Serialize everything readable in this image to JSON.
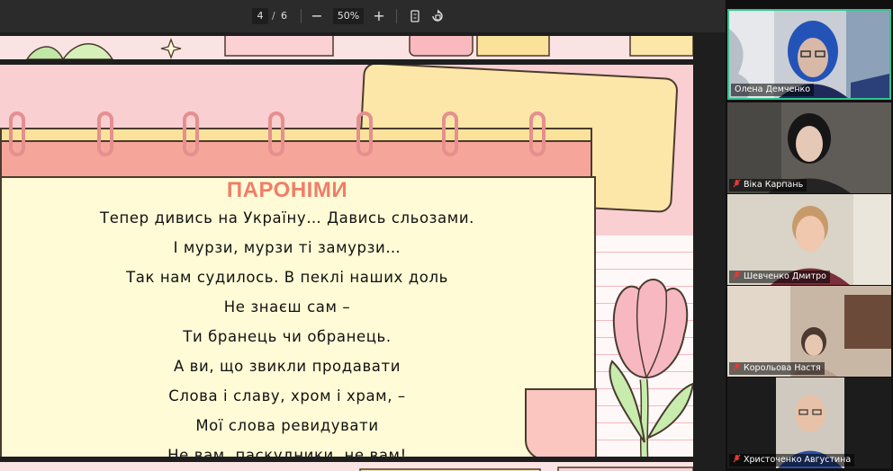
{
  "toolbar": {
    "current_page": "4",
    "separator": "/",
    "total_pages": "6",
    "zoom_out_label": "−",
    "zoom_level": "50%",
    "zoom_in_label": "+",
    "icons": [
      "fit-page-icon",
      "rotate-icon"
    ]
  },
  "slide": {
    "title": "ПАРОНІМИ",
    "lines": [
      "Тепер дивись на Україну… Давись сльозами.",
      "І мурзи, мурзи ті замурзи…",
      "Так нам судилось. В пеклі наших доль",
      "Не знаєш сам –",
      "Ти бранець чи обранець.",
      "А ви, що звикли продавати",
      "Слова і славу, хром і храм, –",
      "Мої слова ревидувати",
      "Не вам, паскудники, не вам!"
    ]
  },
  "participants": [
    {
      "name": "Олена Демченко",
      "muted": false,
      "active": true
    },
    {
      "name": "Віка Карпань",
      "muted": true,
      "active": false
    },
    {
      "name": "Шевченко Дмитро",
      "muted": true,
      "active": false
    },
    {
      "name": "Корольова Настя",
      "muted": true,
      "active": false
    },
    {
      "name": "Христоченко Августина",
      "muted": true,
      "active": false
    }
  ],
  "colors": {
    "title": "#f07d6a",
    "slide_bg": "#f9cfd2",
    "active_speaker": "#34c38f",
    "mic_muted": "#e53935"
  }
}
